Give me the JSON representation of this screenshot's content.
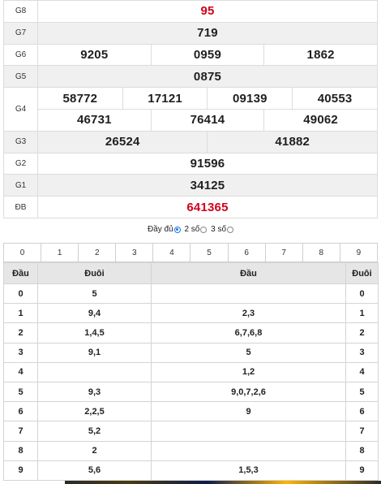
{
  "results": {
    "rows": [
      {
        "label": "G8",
        "values": [
          "95"
        ],
        "red": true
      },
      {
        "label": "G7",
        "values": [
          "719"
        ],
        "red": false
      },
      {
        "label": "G6",
        "values": [
          "9205",
          "0959",
          "1862"
        ],
        "red": false
      },
      {
        "label": "G5",
        "values": [
          "0875"
        ],
        "red": false
      },
      {
        "label": "G4",
        "values": [
          "58772",
          "17121",
          "09139",
          "40553",
          "46731",
          "76414",
          "49062"
        ],
        "red": false
      },
      {
        "label": "G3",
        "values": [
          "26524",
          "41882"
        ],
        "red": false
      },
      {
        "label": "G2",
        "values": [
          "91596"
        ],
        "red": false
      },
      {
        "label": "G1",
        "values": [
          "34125"
        ],
        "red": false
      },
      {
        "label": "ĐB",
        "values": [
          "641365"
        ],
        "red": true
      }
    ]
  },
  "modes": {
    "label": "Đầy đủ",
    "options": [
      {
        "label": "2 số",
        "selected": true
      },
      {
        "label": "3 số",
        "selected": false
      }
    ]
  },
  "digits": [
    "0",
    "1",
    "2",
    "3",
    "4",
    "5",
    "6",
    "7",
    "8",
    "9"
  ],
  "loto": {
    "headers": [
      "Đầu",
      "Đuôi",
      "Đầu",
      "Đuôi"
    ],
    "rows": [
      {
        "dau": "0",
        "duoi": "5",
        "dau2": "",
        "duoi2": "0"
      },
      {
        "dau": "1",
        "duoi": "9,4",
        "dau2": "2,3",
        "duoi2": "1"
      },
      {
        "dau": "2",
        "duoi": "1,4,5",
        "dau2": "6,7,6,8",
        "duoi2": "2"
      },
      {
        "dau": "3",
        "duoi": "9,1",
        "dau2": "5",
        "duoi2": "3"
      },
      {
        "dau": "4",
        "duoi": "",
        "dau2": "1,2",
        "duoi2": "4"
      },
      {
        "dau": "5",
        "duoi": "9,3",
        "dau2": "9,0,7,2,6",
        "duoi2": "5"
      },
      {
        "dau": "6",
        "duoi": "2,2,5",
        "dau2": "9",
        "duoi2": "6"
      },
      {
        "dau": "7",
        "duoi": "5,2",
        "dau2": "",
        "duoi2": "7"
      },
      {
        "dau": "8",
        "duoi": "2",
        "dau2": "",
        "duoi2": "8"
      },
      {
        "dau": "9",
        "duoi": "5,6",
        "dau2": "1,5,3",
        "duoi2": "9"
      }
    ]
  },
  "colors": {
    "accent_red": "#d0021b",
    "radio_blue": "#1a73e8",
    "header_gray": "#e6e6e6"
  }
}
